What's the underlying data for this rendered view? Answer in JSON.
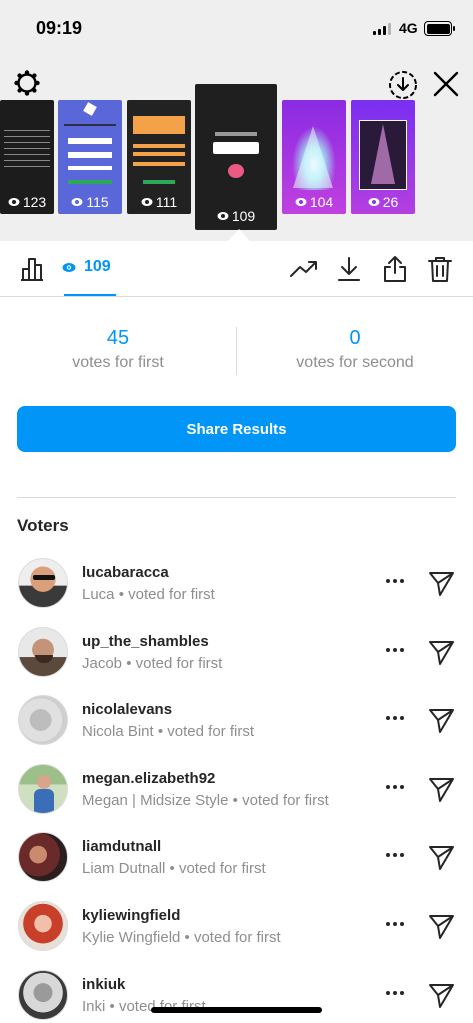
{
  "status_bar": {
    "time": "09:19",
    "network": "4G"
  },
  "stories": [
    {
      "views": "123"
    },
    {
      "views": "115"
    },
    {
      "views": "111"
    },
    {
      "views": "109",
      "selected": true
    },
    {
      "views": "104"
    },
    {
      "views": "26"
    }
  ],
  "toolbar": {
    "views_count": "109"
  },
  "votes": {
    "first_count": "45",
    "first_label": "votes for first",
    "second_count": "0",
    "second_label": "votes for second"
  },
  "share_button": "Share Results",
  "voters_heading": "Voters",
  "voters": [
    {
      "username": "lucabaracca",
      "name": "Luca",
      "vote": "voted for first"
    },
    {
      "username": "up_the_shambles",
      "name": "Jacob",
      "vote": "voted for first"
    },
    {
      "username": "nicolalevans",
      "name": "Nicola Bint",
      "vote": "voted for first"
    },
    {
      "username": "megan.elizabeth92",
      "name": "Megan | Midsize Style",
      "vote": "voted for first"
    },
    {
      "username": "liamdutnall",
      "name": "Liam Dutnall",
      "vote": "voted for first"
    },
    {
      "username": "kyliewingfield",
      "name": "Kylie Wingfield",
      "vote": "voted for first"
    },
    {
      "username": "inkiuk",
      "name": "Inki",
      "vote": "voted for first"
    }
  ],
  "colors": {
    "accent": "#0095f6",
    "muted": "#8e8e8e",
    "header_bg": "#efefef"
  }
}
